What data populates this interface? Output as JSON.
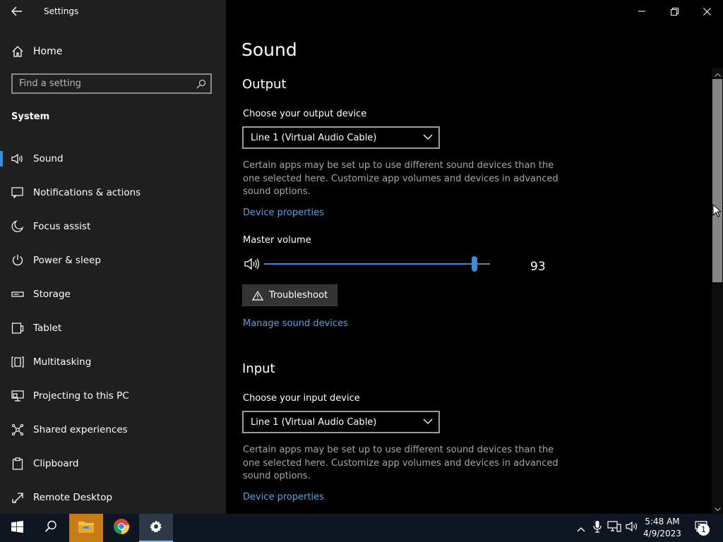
{
  "window": {
    "title": "Settings",
    "controls": {
      "minimize": "minimize",
      "restore": "restore",
      "close": "close"
    }
  },
  "sidebar": {
    "home_label": "Home",
    "search": {
      "placeholder": "Find a setting",
      "value": ""
    },
    "section_heading": "System",
    "items": [
      {
        "label": "Sound",
        "icon": "speaker-icon",
        "active": true
      },
      {
        "label": "Notifications & actions",
        "icon": "notifications-icon"
      },
      {
        "label": "Focus assist",
        "icon": "moon-icon"
      },
      {
        "label": "Power & sleep",
        "icon": "power-icon"
      },
      {
        "label": "Storage",
        "icon": "storage-icon"
      },
      {
        "label": "Tablet",
        "icon": "tablet-icon"
      },
      {
        "label": "Multitasking",
        "icon": "multitasking-icon"
      },
      {
        "label": "Projecting to this PC",
        "icon": "projecting-icon"
      },
      {
        "label": "Shared experiences",
        "icon": "shared-experiences-icon"
      },
      {
        "label": "Clipboard",
        "icon": "clipboard-icon"
      },
      {
        "label": "Remote Desktop",
        "icon": "remote-desktop-icon"
      }
    ]
  },
  "main": {
    "title": "Sound",
    "output": {
      "heading": "Output",
      "device_label": "Choose your output device",
      "device_value": "Line 1 (Virtual Audio Cable)",
      "description": "Certain apps may be set up to use different sound devices than the one selected here. Customize app volumes and devices in advanced sound options.",
      "device_properties_link": "Device properties",
      "master_volume_label": "Master volume",
      "master_volume": "93",
      "troubleshoot_label": "Troubleshoot",
      "manage_link": "Manage sound devices"
    },
    "input": {
      "heading": "Input",
      "device_label": "Choose your input device",
      "device_value": "Line 1 (Virtual Audio Cable)",
      "description": "Certain apps may be set up to use different sound devices than the one selected here. Customize app volumes and devices in advanced sound options.",
      "device_properties_link": "Device properties"
    }
  },
  "scrollbar": {
    "thumb_position_fraction": 0.0,
    "thumb_size_fraction": 0.48
  },
  "taskbar": {
    "apps": [
      "start-icon",
      "search-icon",
      "file-explorer-icon",
      "chrome-icon",
      "settings-icon"
    ],
    "active_app": "settings-icon",
    "tray_icons": [
      "chevron-up-icon",
      "microphone-icon",
      "network-icon",
      "volume-icon"
    ],
    "time": "5:48 AM",
    "date": "4/9/2023",
    "notification_count": "1"
  },
  "colors": {
    "accent": "#3a8ed8",
    "link": "#4ea3e8",
    "sidebar_bg": "#1f1f1f",
    "main_bg": "#000000",
    "taskbar_bg": "#0e1621"
  }
}
